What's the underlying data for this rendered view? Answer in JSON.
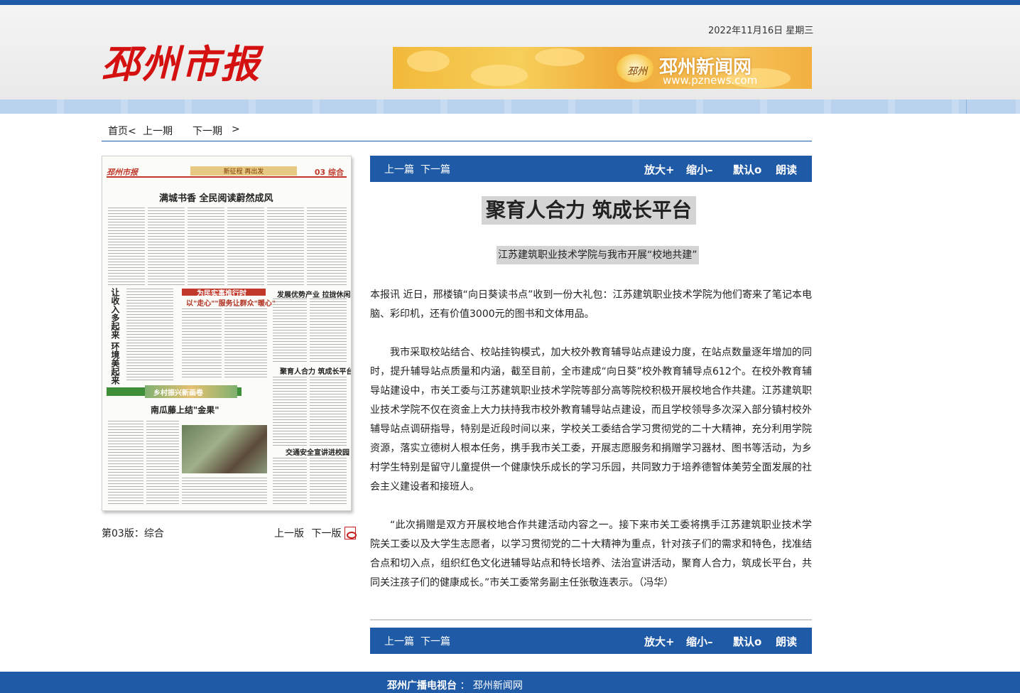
{
  "header": {
    "date": "2022年11月16日  星期三",
    "logo_text": "邳州市报",
    "banner": {
      "title": "邳州新闻网",
      "url": "www.pznews.com",
      "mark": "邳州"
    }
  },
  "nav": {
    "home": "首页<",
    "prev_issue": "上一期",
    "next_issue": "下一期",
    "next_arrow": ">"
  },
  "paper": {
    "logo": "邳州市报",
    "slogan": "新征程 再出发",
    "page_label": "03 综合",
    "headline1": "满城书香  全民阅读蔚然成风",
    "vertical_head": "让收入多起来 环境美起来",
    "section_red": "为民实事推行时",
    "sub_red": "以\"走心\"\"服务让群众\"暖心\"",
    "section_green": "乡村振兴新画卷",
    "headline2": "南瓜藤上结\"金果\"",
    "headline3": "聚育人合力  筑成长平台",
    "headline4": "交通安全宣讲进校园",
    "headline5": "发展优势产业  拉拢休闲增收"
  },
  "page_caption": {
    "prefix": "第03版：",
    "section": "综合",
    "prev_page": "上一版",
    "next_page": "下一版"
  },
  "toolbar": {
    "prev_article": "上一篇",
    "next_article": "下一篇",
    "zoom_in": "放大+",
    "zoom_out": "缩小–",
    "default": "默认o",
    "read_aloud": "朗读"
  },
  "article": {
    "title": "聚育人合力 筑成长平台",
    "subtitle": "江苏建筑职业技术学院与我市开展“校地共建”",
    "paragraphs": [
      "本报讯 近日，邢楼镇“向日葵读书点”收到一份大礼包：江苏建筑职业技术学院为他们寄来了笔记本电脑、彩印机，还有价值3000元的图书和文体用品。",
      "我市采取校站结合、校站挂钩模式，加大校外教育辅导站点建设力度，在站点数量逐年增加的同时，提升辅导站点质量和内涵，截至目前，全市建成“向日葵”校外教育辅导点612个。在校外教育辅导站建设中，市关工委与江苏建筑职业技术学院等部分高等院校积极开展校地合作共建。江苏建筑职业技术学院不仅在资金上大力扶持我市校外教育辅导站点建设，而且学校领导多次深入部分镇村校外辅导站点调研指导，特别是近段时间以来，学校关工委结合学习贯彻党的二十大精神，充分利用学院资源，落实立德树人根本任务，携手我市关工委，开展志愿服务和捐赠学习器材、图书等活动，为乡村学生特别是留守儿童提供一个健康快乐成长的学习乐园，共同致力于培养德智体美劳全面发展的社会主义建设者和接班人。",
      "“此次捐赠是双方开展校地合作共建活动内容之一。接下来市关工委将携手江苏建筑职业技术学院关工委以及大学生志愿者，以学习贯彻党的二十大精神为重点，针对孩子们的需求和特色，找准结合点和切入点，组织红色文化进辅导站点和特长培养、法治宣讲活动，聚育人合力，筑成长平台，共同关注孩子们的健康成长。”市关工委常务副主任张敬连表示。（冯华）"
    ]
  },
  "footer": {
    "station": "邳州广播电视台",
    "separator": "：",
    "site": "邳州新闻网"
  },
  "colors": {
    "brand_blue": "#1f5aa6",
    "logo_red": "#d41010",
    "highlight_gray": "#d4d4d4"
  }
}
